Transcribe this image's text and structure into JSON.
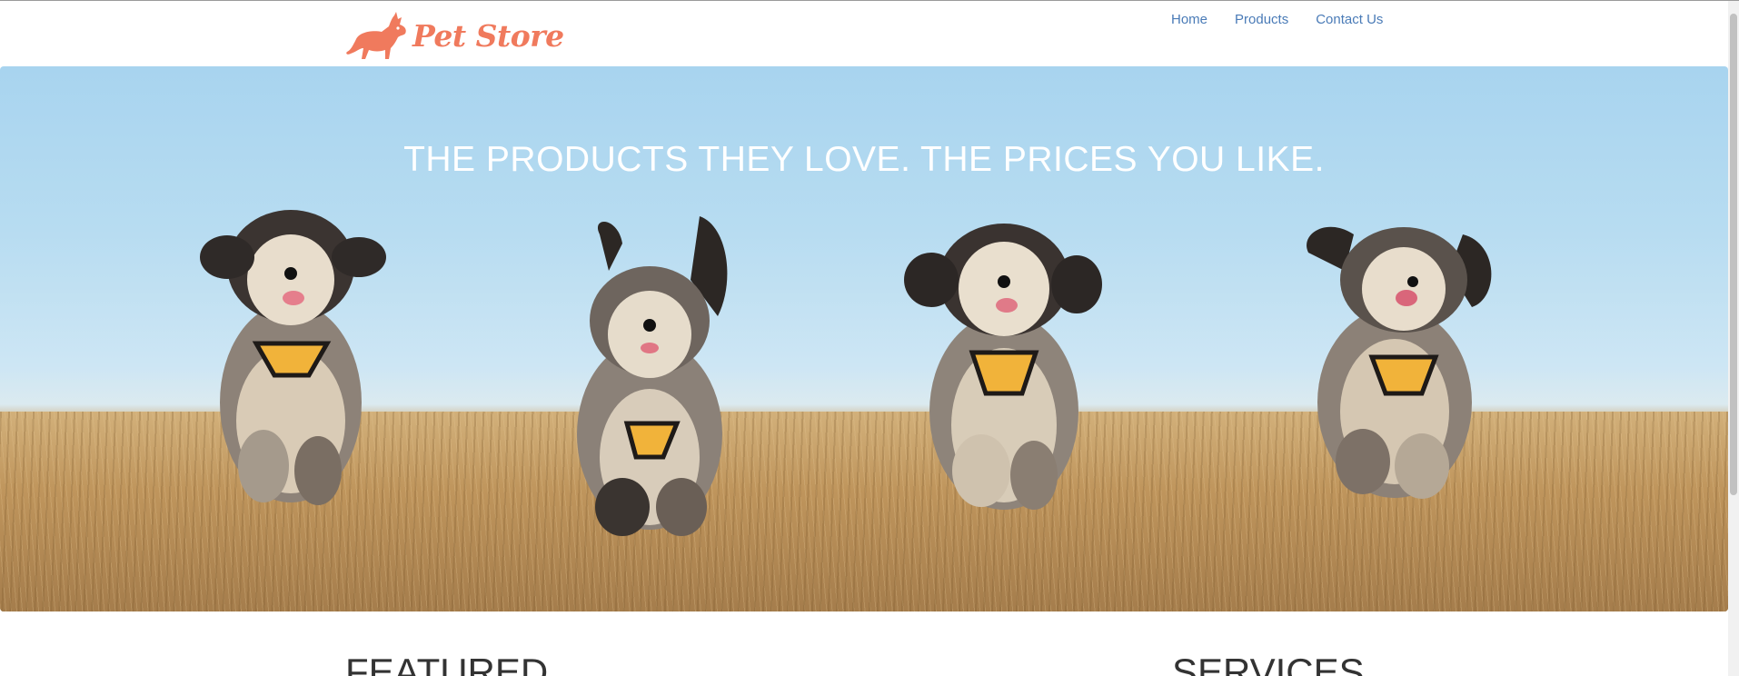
{
  "brand": {
    "name": "Pet Store",
    "logo_icon": "dog-icon",
    "color": "#f07a5d"
  },
  "nav": {
    "items": [
      {
        "label": "Home"
      },
      {
        "label": "Products"
      },
      {
        "label": "Contact Us"
      }
    ],
    "link_color": "#4a7bb7"
  },
  "hero": {
    "title": "THE PRODUCTS THEY LOVE. THE PRICES YOU LIKE.",
    "image_icon": "running-dogs-photo"
  },
  "sections": {
    "featured": "FEATURED",
    "services": "SERVICES"
  }
}
